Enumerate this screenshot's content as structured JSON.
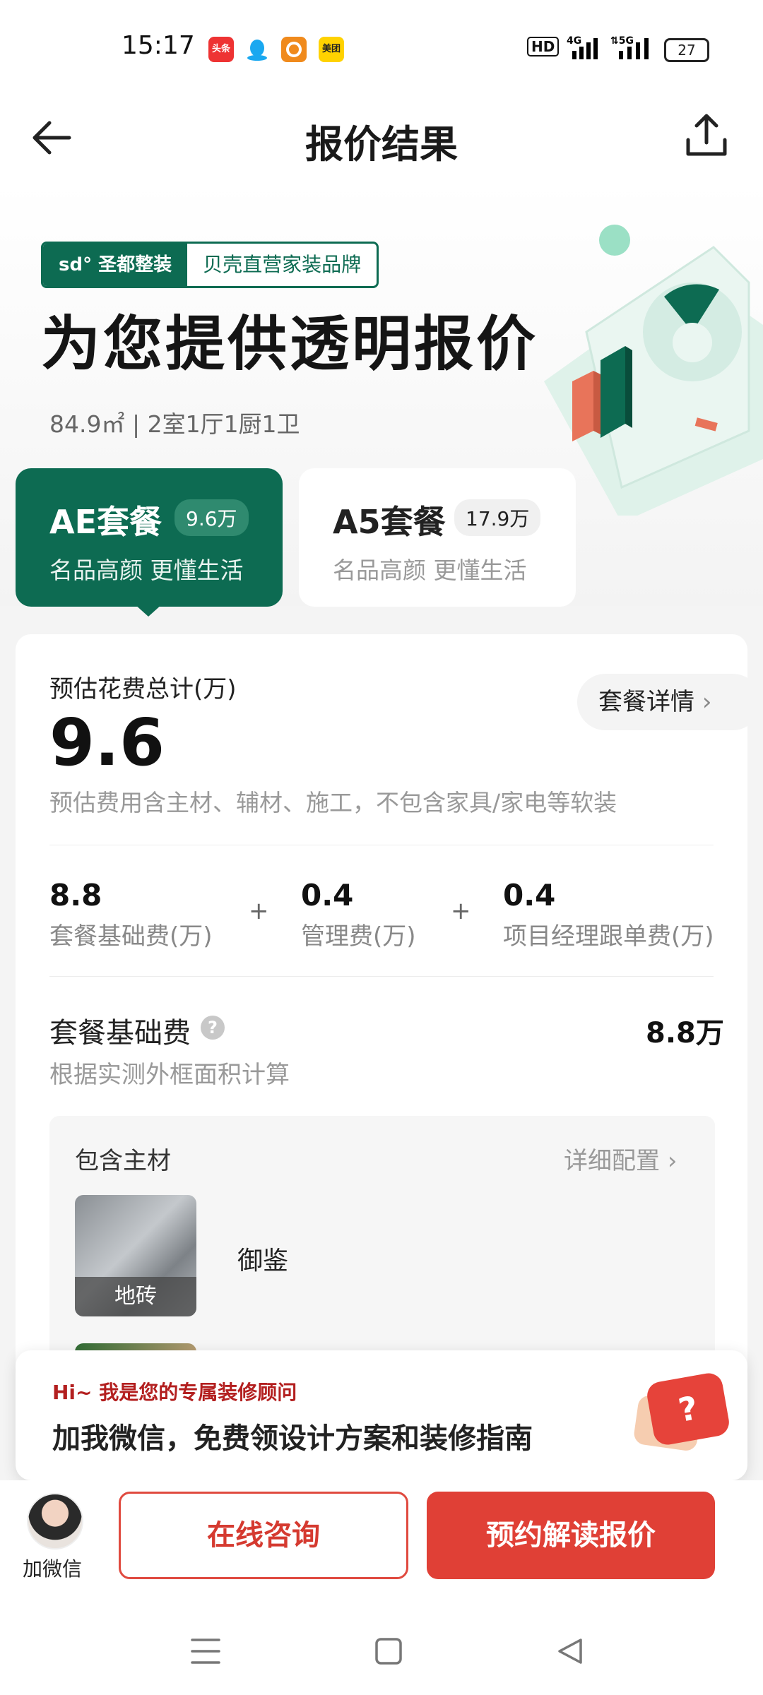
{
  "status_bar": {
    "time": "15:17",
    "apps": [
      "头条",
      "QQ",
      "今日头条",
      "美团"
    ],
    "hd": "HD",
    "signal1": "4G",
    "signal2": "5G",
    "battery": "27"
  },
  "nav": {
    "title": "报价结果",
    "back_icon": "arrow-left-icon",
    "share_icon": "share-icon"
  },
  "hero": {
    "brand_logo": "sd° 圣都整装",
    "brand_slogan": "贝壳直营家装品牌",
    "headline": "为您提供透明报价",
    "house_info": "84.9㎡ | 2室1厅1厨1卫"
  },
  "packages": [
    {
      "name": "AE套餐",
      "price": "9.6万",
      "subtitle": "名品高颜 更懂生活",
      "selected": true
    },
    {
      "name": "A5套餐",
      "price": "17.9万",
      "subtitle": "名品高颜 更懂生活",
      "selected": false
    }
  ],
  "summary": {
    "total_label": "预估花费总计(万)",
    "total_value": "9.6",
    "detail_button": "套餐详情",
    "note": "预估费用含主材、辅材、施工，不包含家具/家电等软装",
    "fees": [
      {
        "value": "8.8",
        "label": "套餐基础费(万)"
      },
      {
        "value": "0.4",
        "label": "管理费(万)"
      },
      {
        "value": "0.4",
        "label": "项目经理跟单费(万)"
      }
    ],
    "plus": "+"
  },
  "base_fee": {
    "title": "套餐基础费",
    "value": "8.8万",
    "note": "根据实测外框面积计算"
  },
  "materials": {
    "title": "包含主材",
    "link": "详细配置",
    "items": [
      {
        "caption": "地砖",
        "brand": "御鉴"
      }
    ]
  },
  "banner": {
    "hi": "Hi~ 我是您的专属装修顾问",
    "message": "加我微信，免费领设计方案和装修指南",
    "bubble": "?"
  },
  "bottom": {
    "wechat_label": "加微信",
    "consult_button": "在线咨询",
    "book_button": "预约解读报价"
  },
  "colors": {
    "brand_green": "#0d6b52",
    "accent_red": "#e04036"
  }
}
